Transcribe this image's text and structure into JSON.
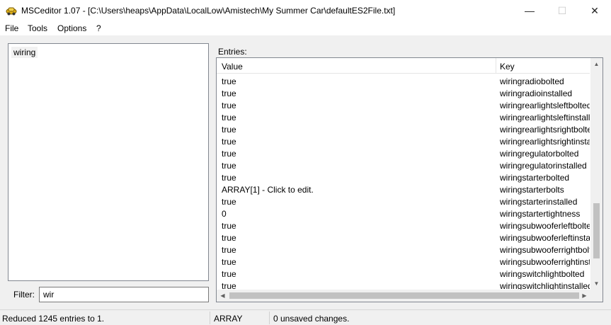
{
  "window": {
    "title": "MSCeditor 1.07 - [C:\\Users\\heaps\\AppData\\LocalLow\\Amistech\\My Summer Car\\defaultES2File.txt]",
    "minimize": "—",
    "maximize": "☐",
    "close": "✕",
    "app_icon": "car-icon"
  },
  "menu": [
    "File",
    "Tools",
    "Options",
    "?"
  ],
  "groups": {
    "items": [
      "wiring"
    ]
  },
  "filter": {
    "label": "Filter:",
    "value": "wir"
  },
  "entries": {
    "label": "Entries:",
    "columns": [
      "Value",
      "Key"
    ],
    "rows": [
      {
        "value": "true",
        "key": "wiringradiobolted"
      },
      {
        "value": "true",
        "key": "wiringradioinstalled"
      },
      {
        "value": "true",
        "key": "wiringrearlightsleftbolted"
      },
      {
        "value": "true",
        "key": "wiringrearlightsleftinstalled"
      },
      {
        "value": "true",
        "key": "wiringrearlightsrightbolted"
      },
      {
        "value": "true",
        "key": "wiringrearlightsrightinstalle"
      },
      {
        "value": "true",
        "key": "wiringregulatorbolted"
      },
      {
        "value": "true",
        "key": "wiringregulatorinstalled"
      },
      {
        "value": "true",
        "key": "wiringstarterbolted"
      },
      {
        "value": "ARRAY[1] - Click to edit.",
        "key": "wiringstarterbolts"
      },
      {
        "value": "true",
        "key": "wiringstarterinstalled"
      },
      {
        "value": "0",
        "key": "wiringstartertightness"
      },
      {
        "value": "true",
        "key": "wiringsubwooferleftbolted"
      },
      {
        "value": "true",
        "key": "wiringsubwooferleftinstalle"
      },
      {
        "value": "true",
        "key": "wiringsubwooferrightbolted"
      },
      {
        "value": "true",
        "key": "wiringsubwooferrightinstal"
      },
      {
        "value": "true",
        "key": "wiringswitchlightbolted"
      },
      {
        "value": "true",
        "key": "wiringswitchlightinstalled"
      }
    ]
  },
  "status": {
    "summary": "Reduced 1245 entries to 1.",
    "type": "ARRAY",
    "changes": "0 unsaved changes."
  }
}
